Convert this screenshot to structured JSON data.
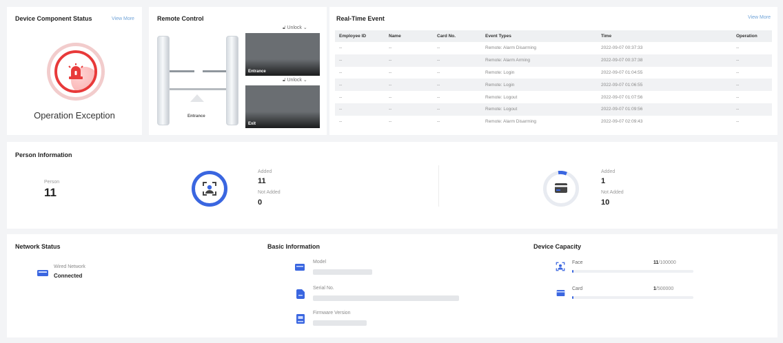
{
  "device_status": {
    "title": "Device Component Status",
    "view_more": "View More",
    "status_text": "Operation Exception",
    "icon": "alarm-siren-icon",
    "color": "#e83a3a"
  },
  "remote": {
    "title": "Remote Control",
    "unlock_1": "Unlock",
    "unlock_2": "Unlock",
    "gate_label": "Entrance",
    "cam_1_label": "Entrance",
    "cam_2_label": "Exit"
  },
  "events": {
    "title": "Real-Time Event",
    "view_more": "View More",
    "columns": [
      "Employee ID",
      "Name",
      "Card No.",
      "Event Types",
      "Time",
      "Operation"
    ],
    "rows": [
      [
        "--",
        "--",
        "--",
        "Remote: Alarm Disarming",
        "2022-09-07 00:37:33",
        "--"
      ],
      [
        "--",
        "--",
        "--",
        "Remote: Alarm Arming",
        "2022-09-07 00:37:38",
        "--"
      ],
      [
        "--",
        "--",
        "--",
        "Remote: Login",
        "2022-09-07 01:04:55",
        "--"
      ],
      [
        "--",
        "--",
        "--",
        "Remote: Login",
        "2022-09-07 01:06:55",
        "--"
      ],
      [
        "--",
        "--",
        "--",
        "Remote: Logout",
        "2022-09-07 01:07:56",
        "--"
      ],
      [
        "--",
        "--",
        "--",
        "Remote: Logout",
        "2022-09-07 01:09:56",
        "--"
      ],
      [
        "--",
        "--",
        "--",
        "Remote: Alarm Disarming",
        "2022-09-07 02:09:43",
        "--"
      ]
    ]
  },
  "person": {
    "title": "Person Information",
    "person_label": "Person",
    "person_count": "11",
    "face": {
      "added_label": "Added",
      "added": "11",
      "not_added_label": "Not Added",
      "not_added": "0",
      "icon": "face-icon"
    },
    "card": {
      "added_label": "Added",
      "added": "1",
      "not_added_label": "Not Added",
      "not_added": "10",
      "icon": "card-icon"
    }
  },
  "network": {
    "title": "Network Status",
    "type_label": "Wired Network",
    "state": "Connected",
    "icon": "wired-network-icon"
  },
  "basic": {
    "title": "Basic Information",
    "model_label": "Model",
    "serial_label": "Serial No.",
    "firmware_label": "Firmware Version"
  },
  "capacity": {
    "title": "Device Capacity",
    "face_label": "Face",
    "face_used": "11",
    "face_total": "/100000",
    "face_fraction": 0.00011,
    "card_label": "Card",
    "card_used": "1",
    "card_total": "/500000",
    "card_fraction": 2e-06
  },
  "colors": {
    "accent": "#3a66e0",
    "danger": "#e83a3a",
    "link": "#6fa3d8"
  }
}
